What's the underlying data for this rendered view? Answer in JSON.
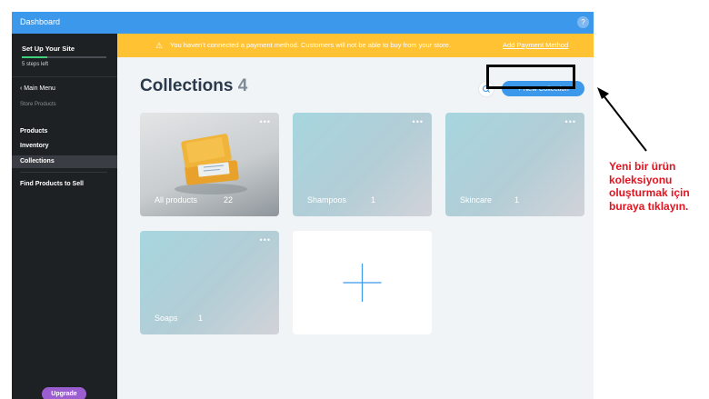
{
  "topbar": {
    "title": "Dashboard",
    "help_label": "?"
  },
  "sidebar": {
    "setup_title": "Set Up Your Site",
    "steps_left": "5 steps left",
    "setup_progress": 0.3,
    "main_menu": "Main Menu",
    "section_label": "Store Products",
    "items": [
      {
        "label": "Products"
      },
      {
        "label": "Inventory"
      },
      {
        "label": "Collections"
      },
      {
        "label": "Find Products to Sell"
      }
    ],
    "upgrade_label": "Upgrade"
  },
  "banner": {
    "message": "You haven’t connected a payment method. Customers will not be able to buy from your store.",
    "link": "Add Payment Method"
  },
  "page": {
    "title": "Collections",
    "count": "4",
    "new_button": "+ New Collection"
  },
  "collections": [
    {
      "name": "All products",
      "count": "22"
    },
    {
      "name": "Shampoos",
      "count": "1"
    },
    {
      "name": "Skincare",
      "count": "1"
    },
    {
      "name": "Soaps",
      "count": "1"
    }
  ],
  "annotation": {
    "lines": [
      "Yeni bir ürün",
      "koleksiyonu",
      "oluşturmak için",
      "buraya tıklayın."
    ],
    "color": "#e3141f"
  }
}
